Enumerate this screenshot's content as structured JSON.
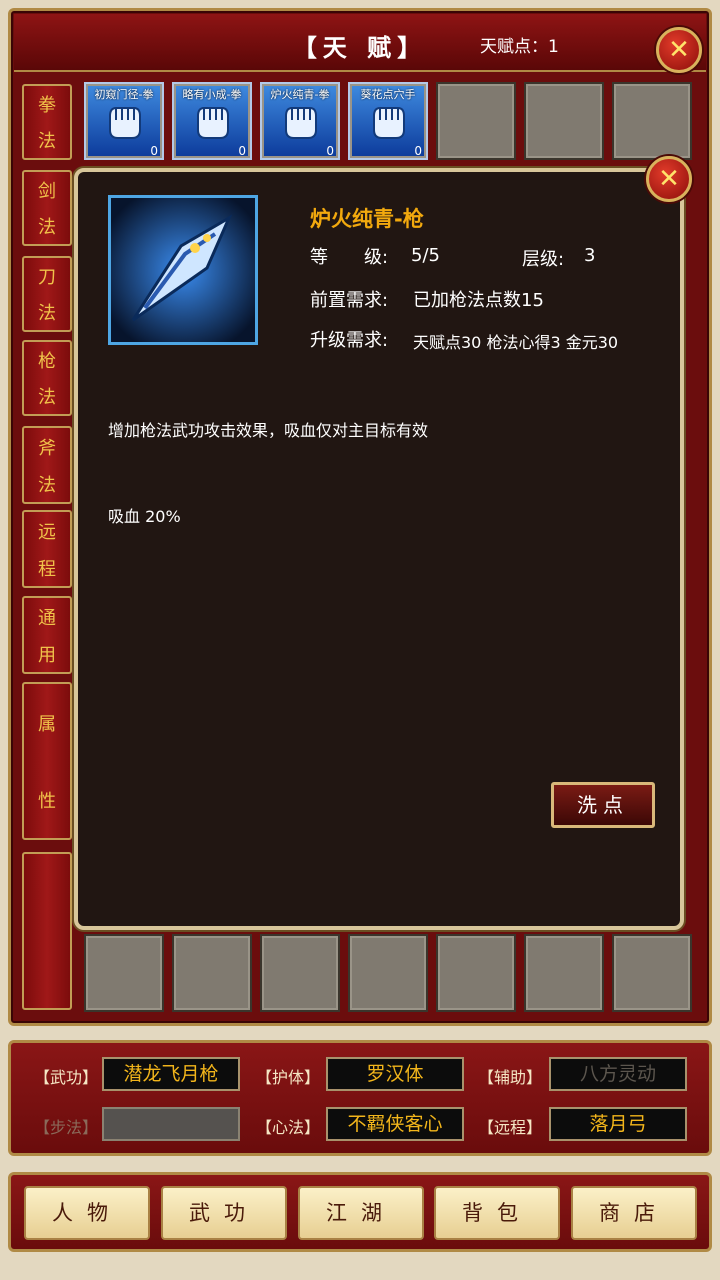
{
  "header": {
    "title": "【天 赋】",
    "points_label": "天赋点：1"
  },
  "sidebar": [
    {
      "label": "拳法",
      "c1": "拳",
      "c2": "法"
    },
    {
      "label": "剑法",
      "c1": "剑",
      "c2": "法"
    },
    {
      "label": "刀法",
      "c1": "刀",
      "c2": "法"
    },
    {
      "label": "枪法",
      "c1": "枪",
      "c2": "法"
    },
    {
      "label": "斧法",
      "c1": "斧",
      "c2": "法"
    },
    {
      "label": "远程",
      "c1": "远",
      "c2": "程"
    },
    {
      "label": "通用",
      "c1": "通",
      "c2": "用"
    },
    {
      "label": "属性",
      "c1": "属",
      "c2": "性"
    }
  ],
  "top_slots": [
    {
      "name": "初窥门径-拳",
      "level": "0",
      "icon": "fist-icon"
    },
    {
      "name": "略有小成-拳",
      "level": "0",
      "icon": "fist-icon"
    },
    {
      "name": "炉火纯青-拳",
      "level": "0",
      "icon": "fist-icon"
    },
    {
      "name": "葵花点穴手",
      "level": "0",
      "icon": "fist-icon"
    }
  ],
  "detail": {
    "name": "炉火纯青-枪",
    "level_label": "等　　级:",
    "level_value": "5/5",
    "tier_label": "层级:",
    "tier_value": "3",
    "prereq_label": "前置需求:",
    "prereq_value": "已加枪法点数15",
    "upgrade_label": "升级需求:",
    "upgrade_value": "天赋点30 枪法心得3 金元30",
    "description": "增加枪法武功攻击效果，吸血仅对主目标有效",
    "effect": "吸血  20%",
    "icon": "spear-icon",
    "wash_button": "洗点"
  },
  "equip": {
    "wugong_label": "【武功】",
    "wugong_value": "潜龙飞月枪",
    "huti_label": "【护体】",
    "huti_value": "罗汉体",
    "fuzhu_label": "【辅助】",
    "fuzhu_value": "八方灵动",
    "bufa_label": "【步法】",
    "bufa_value": "",
    "xinfa_label": "【心法】",
    "xinfa_value": "不羁侠客心",
    "yuancheng_label": "【远程】",
    "yuancheng_value": "落月弓"
  },
  "nav": [
    "人物",
    "武功",
    "江湖",
    "背包",
    "商店"
  ],
  "colors": {
    "gold_text": "#f2a90e",
    "frame_red": "#6b0d0d",
    "tab_text": "#f0c24a"
  }
}
